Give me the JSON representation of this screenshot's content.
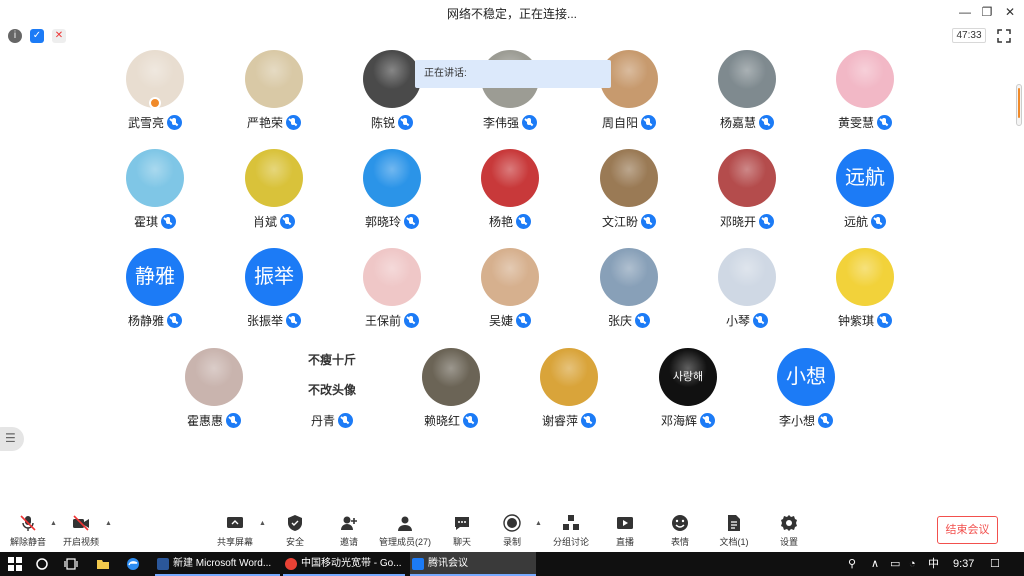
{
  "window": {
    "title": "网络不稳定，正在连接...",
    "timer": "47:33"
  },
  "speaking": {
    "label": "正在讲话:"
  },
  "sidebar_toggle_icon": "list-icon",
  "participants": [
    {
      "name": "武雪亮",
      "avatar": "photo",
      "avatar_color": "#e8ddd0"
    },
    {
      "name": "严艳荣",
      "avatar": "photo",
      "avatar_color": "#d9c9a6"
    },
    {
      "name": "陈锐",
      "avatar": "photo",
      "avatar_color": "#4a4a4a"
    },
    {
      "name": "李伟强",
      "avatar": "photo",
      "avatar_color": "#9c9c94"
    },
    {
      "name": "周自阳",
      "avatar": "photo",
      "avatar_color": "#c79a6e"
    },
    {
      "name": "杨嘉慧",
      "avatar": "photo",
      "avatar_color": "#7f8a8f"
    },
    {
      "name": "黄雯慧",
      "avatar": "photo",
      "avatar_color": "#f2b8c6"
    },
    {
      "name": "霍琪",
      "avatar": "photo",
      "avatar_color": "#7fc6e6"
    },
    {
      "name": "肖斌",
      "avatar": "photo",
      "avatar_color": "#d9c23a"
    },
    {
      "name": "郭晓玲",
      "avatar": "photo",
      "avatar_color": "#2b94e8"
    },
    {
      "name": "杨艳",
      "avatar": "photo",
      "avatar_color": "#c8393a"
    },
    {
      "name": "文江盼",
      "avatar": "photo",
      "avatar_color": "#9a7a55"
    },
    {
      "name": "邓晓开",
      "avatar": "photo",
      "avatar_color": "#b44c4c"
    },
    {
      "name": "远航",
      "avatar": "text",
      "avatar_text": "远航"
    },
    {
      "name": "杨静雅",
      "avatar": "text",
      "avatar_text": "静雅"
    },
    {
      "name": "张振举",
      "avatar": "text",
      "avatar_text": "振举"
    },
    {
      "name": "王保前",
      "avatar": "photo",
      "avatar_color": "#efc7c7"
    },
    {
      "name": "吴婕",
      "avatar": "photo",
      "avatar_color": "#d6b08e"
    },
    {
      "name": "张庆",
      "avatar": "photo",
      "avatar_color": "#88a0b8"
    },
    {
      "name": "小琴",
      "avatar": "photo",
      "avatar_color": "#cfd8e4"
    },
    {
      "name": "钟紫琪",
      "avatar": "photo",
      "avatar_color": "#f2d23a"
    },
    {
      "name": "霍惠惠",
      "avatar": "photo",
      "avatar_color": "#c9b4ae"
    },
    {
      "name": "丹青",
      "avatar": "poem",
      "poem_lines": [
        "不瘦十斤",
        "不改头像"
      ]
    },
    {
      "name": "赖晓红",
      "avatar": "photo",
      "avatar_color": "#6b6456"
    },
    {
      "name": "谢睿萍",
      "avatar": "photo",
      "avatar_color": "#d9a43a"
    },
    {
      "name": "邓海辉",
      "avatar": "photo",
      "avatar_color": "#111111",
      "avatar_text": "사랑해"
    },
    {
      "name": "李小想",
      "avatar": "text",
      "avatar_text": "小想"
    }
  ],
  "toolbar": {
    "unmute": "解除静音",
    "start_video": "开启视频",
    "share_screen": "共享屏幕",
    "security": "安全",
    "invite": "邀请",
    "manage_members": "管理成员(27)",
    "chat": "聊天",
    "record": "录制",
    "breakout": "分组讨论",
    "live": "直播",
    "reactions": "表情",
    "documents": "文档(1)",
    "settings": "设置",
    "end_meeting": "结束会议"
  },
  "taskbar": {
    "app_word": "新建 Microsoft Word...",
    "app_chrome": "中国移动光宽带 - Go...",
    "app_meeting": "腾讯会议",
    "ime": "中",
    "time": "9:37"
  },
  "colors": {
    "accent": "#1c7bf6",
    "end_red": "#f2504d",
    "speaking_bg": "#dce9fb"
  }
}
